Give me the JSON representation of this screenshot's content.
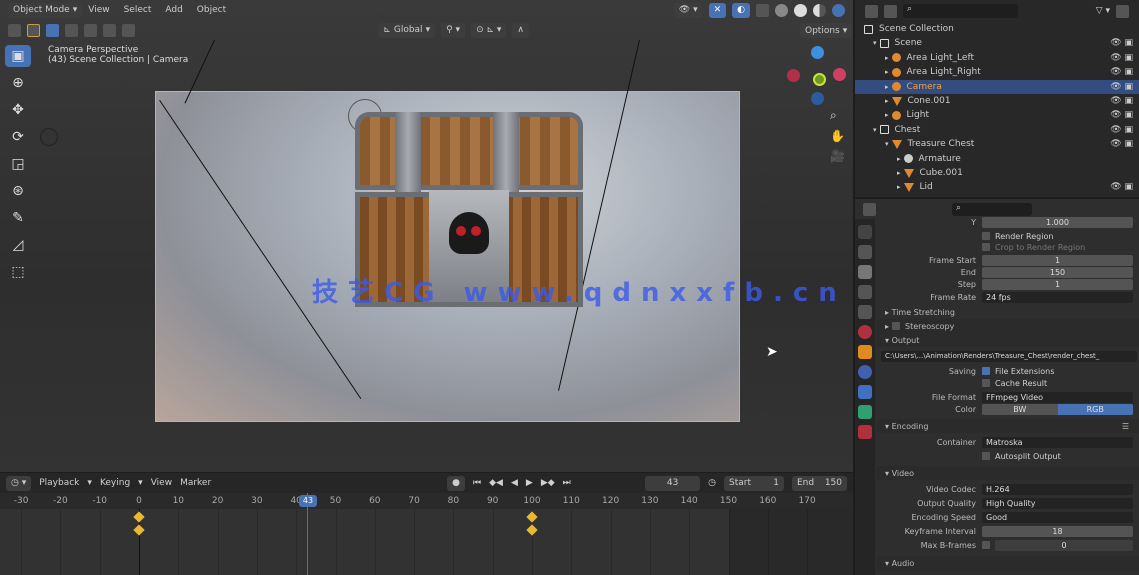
{
  "viewport": {
    "mode": "Object Mode",
    "menus": [
      "View",
      "Select",
      "Add",
      "Object"
    ],
    "orientation": "Global",
    "overlay_label": "Options",
    "info_title": "Camera Perspective",
    "info_subtitle": "(43) Scene Collection | Camera",
    "watermark": "技艺CG www.qdnxxfb.cn",
    "tools": [
      "select-box-icon",
      "cursor-icon",
      "move-icon",
      "rotate-icon",
      "scale-icon",
      "transform-icon",
      "annotate-icon",
      "measure-icon",
      "add-cube-icon"
    ]
  },
  "timeline": {
    "menus": [
      "Playback",
      "Keying",
      "View",
      "Marker"
    ],
    "current_frame": "43",
    "start_label": "Start",
    "start": "1",
    "end_label": "End",
    "end": "150",
    "ticks": [
      -30,
      -20,
      -10,
      0,
      10,
      20,
      30,
      40,
      50,
      60,
      70,
      80,
      90,
      100,
      110,
      120,
      130,
      140,
      150,
      160,
      170
    ],
    "playhead_frame": 43,
    "keyframes": [
      0,
      100
    ],
    "accent": "#4772b3",
    "key_color": "#e8b830"
  },
  "outliner": {
    "rows": [
      {
        "label": "Scene Collection",
        "indent": 0,
        "type": "collection"
      },
      {
        "label": "Scene",
        "indent": 1,
        "type": "collection"
      },
      {
        "label": "Area Light_Left",
        "indent": 2,
        "type": "light"
      },
      {
        "label": "Area Light_Right",
        "indent": 2,
        "type": "light"
      },
      {
        "label": "Camera",
        "indent": 2,
        "type": "camera",
        "selected": true
      },
      {
        "label": "Cone.001",
        "indent": 2,
        "type": "mesh"
      },
      {
        "label": "Light",
        "indent": 2,
        "type": "light"
      },
      {
        "label": "Chest",
        "indent": 1,
        "type": "collection"
      },
      {
        "label": "Treasure Chest",
        "indent": 2,
        "type": "mesh"
      },
      {
        "label": "Armature",
        "indent": 3,
        "type": "armature"
      },
      {
        "label": "Cube.001",
        "indent": 3,
        "type": "mesh"
      },
      {
        "label": "Lid",
        "indent": 3,
        "type": "mesh"
      }
    ]
  },
  "properties": {
    "y_value": "1.000",
    "render_region": "Render Region",
    "crop": "Crop to Render Region",
    "frame_start_label": "Frame Start",
    "frame_start": "1",
    "end_label": "End",
    "end": "150",
    "step_label": "Step",
    "step": "1",
    "frame_rate_label": "Frame Rate",
    "frame_rate": "24 fps",
    "time_stretching": "Time Stretching",
    "stereoscopy": "Stereoscopy",
    "output": "Output",
    "output_path": "C:\\Users\\...\\Animation\\Renders\\Treasure_Chest\\render_chest_",
    "saving_label": "Saving",
    "file_ext": "File Extensions",
    "cache_result": "Cache Result",
    "file_format_label": "File Format",
    "file_format": "FFmpeg Video",
    "color_label": "Color",
    "bw": "BW",
    "rgb": "RGB",
    "encoding": "Encoding",
    "container_label": "Container",
    "container": "Matroska",
    "autosplit": "Autosplit Output",
    "video": "Video",
    "codec_label": "Video Codec",
    "codec": "H.264",
    "quality_label": "Output Quality",
    "quality": "High Quality",
    "speed_label": "Encoding Speed",
    "speed": "Good",
    "keyframe_label": "Keyframe Interval",
    "keyframe": "18",
    "bframes_label": "Max B-frames",
    "bframes": "0",
    "audio": "Audio"
  }
}
